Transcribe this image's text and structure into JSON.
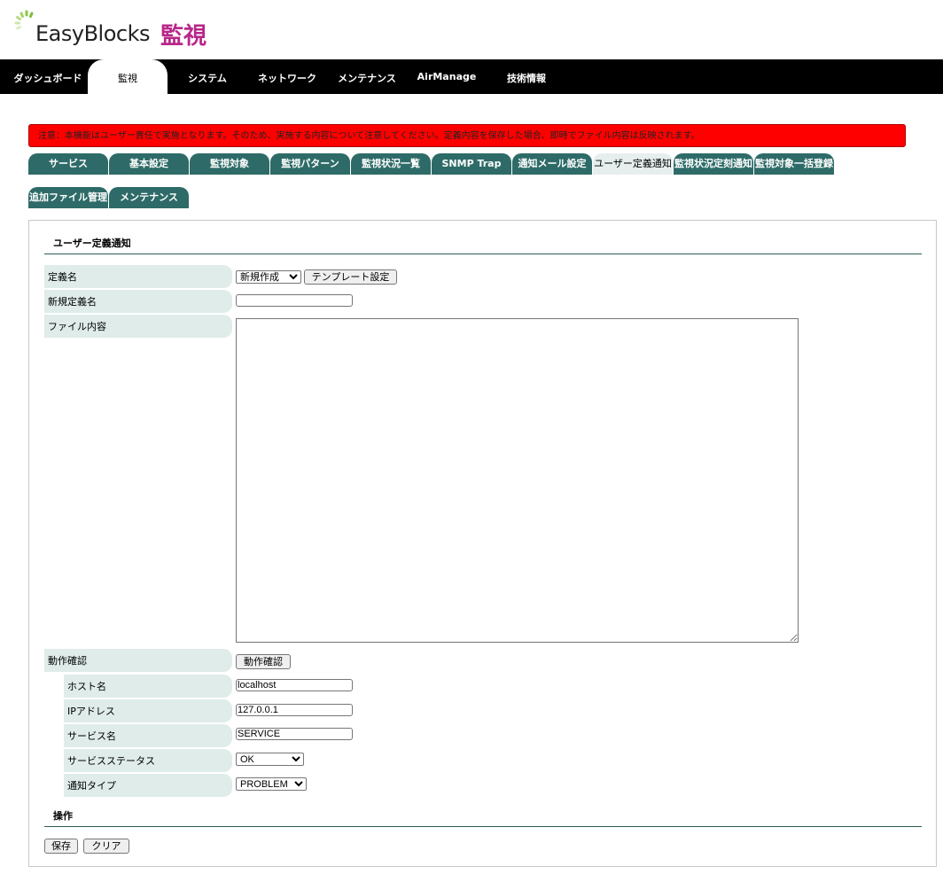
{
  "header": {
    "logo_text": "EasyBlocks",
    "page_title": "監視"
  },
  "main_nav": [
    {
      "label": "ダッシュボード"
    },
    {
      "label": "監視"
    },
    {
      "label": "システム"
    },
    {
      "label": "ネットワーク"
    },
    {
      "label": "メンテナンス"
    },
    {
      "label": "AirManage"
    },
    {
      "label": "技術情報"
    }
  ],
  "warning_text": "注意：本機能はユーザー責任で実施となります。そのため、実施する内容について注意してください。定義内容を保存した場合、即時でファイル内容は反映されます。",
  "sub_tabs": [
    {
      "label": "サービス"
    },
    {
      "label": "基本設定"
    },
    {
      "label": "監視対象"
    },
    {
      "label": "監視パターン"
    },
    {
      "label": "監視状況一覧"
    },
    {
      "label": "SNMP Trap"
    },
    {
      "label": "通知メール設定"
    },
    {
      "label": "ユーザー定義通知"
    },
    {
      "label": "監視状況定刻通知"
    },
    {
      "label": "監視対象一括登録"
    },
    {
      "label": "追加ファイル管理"
    },
    {
      "label": "メンテナンス"
    }
  ],
  "form": {
    "section_title": "ユーザー定義通知",
    "definition_name_label": "定義名",
    "definition_select_value": "新規作成",
    "template_button": "テンプレート設定",
    "new_definition_label": "新規定義名",
    "new_definition_value": "",
    "file_content_label": "ファイル内容",
    "file_content_value": "",
    "test_label": "動作確認",
    "test_button": "動作確認",
    "host_label": "ホスト名",
    "host_value": "localhost",
    "ip_label": "IPアドレス",
    "ip_value": "127.0.0.1",
    "service_label": "サービス名",
    "service_value": "SERVICE",
    "service_status_label": "サービスステータス",
    "service_status_value": "OK",
    "notify_type_label": "通知タイプ",
    "notify_type_value": "PROBLEM"
  },
  "operations": {
    "title": "操作",
    "save_button": "保存",
    "clear_button": "クリア"
  },
  "colors": {
    "nav_bg": "#000000",
    "tab_bg": "#2e6b68",
    "label_bg": "#dfecea",
    "warning_bg": "#ff0000",
    "title_accent": "#b8278a"
  }
}
